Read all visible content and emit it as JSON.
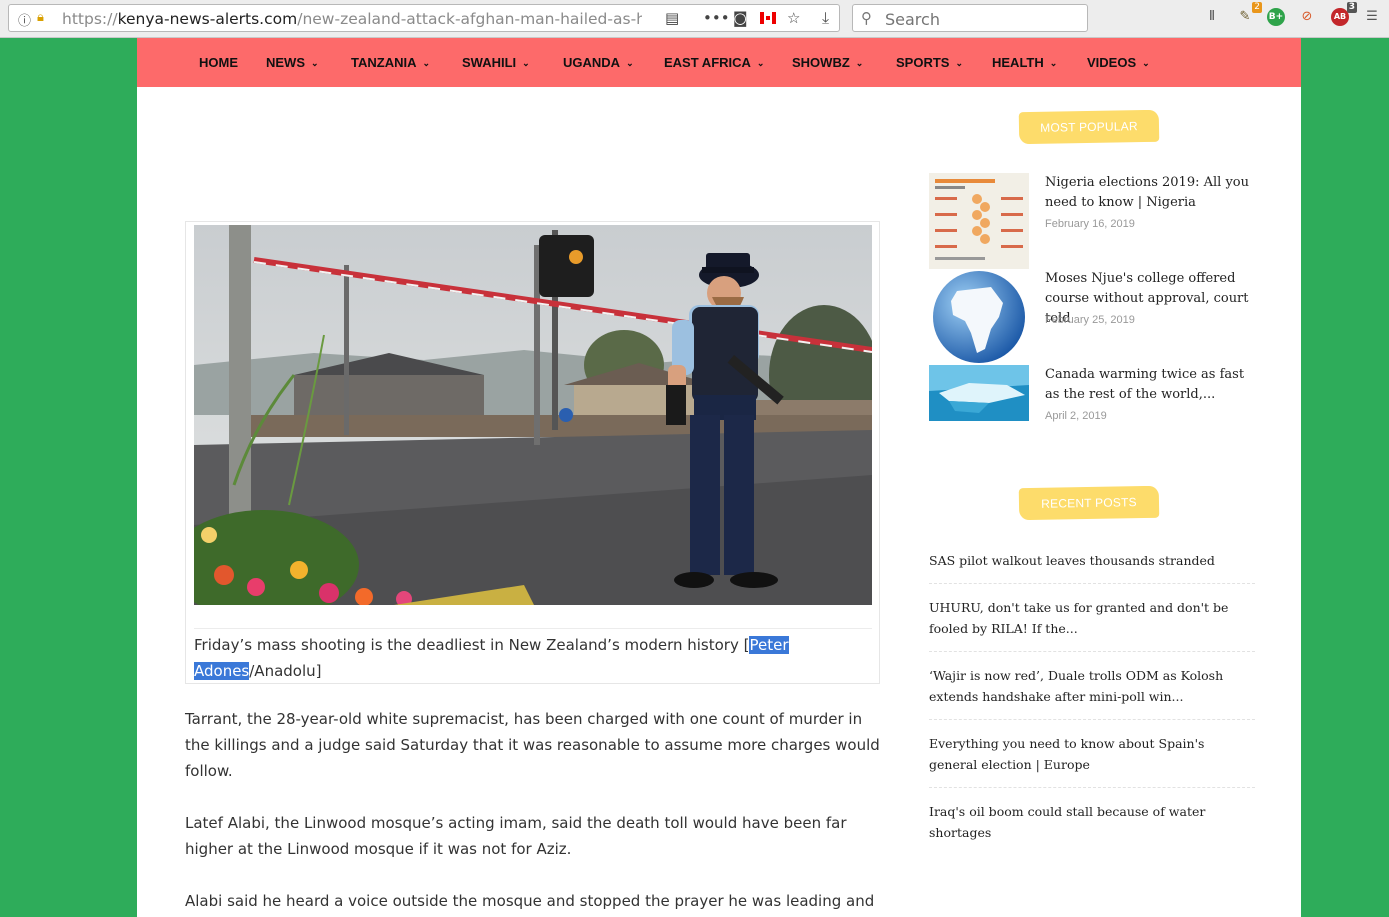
{
  "browser": {
    "url_prefix": "https://",
    "url_domain": "kenya-news-alerts.com",
    "url_path": "/new-zealand-attack-afghan-man-hailed-as-h",
    "search_placeholder": "Search",
    "ext_badge_1": "2",
    "ext_badge_2": "3"
  },
  "nav": {
    "items": [
      "HOME",
      "NEWS",
      "TANZANIA",
      "SWAHILI",
      "UGANDA",
      "EAST AFRICA",
      "SHOWBZ",
      "SPORTS",
      "HEALTH",
      "VIDEOS"
    ]
  },
  "article": {
    "caption_pre": "Friday’s mass shooting is the deadliest in New Zealand’s modern history [",
    "caption_highlight": "Peter Adones",
    "caption_post": "/Anadolu]",
    "paragraphs": [
      "Tarrant, the 28-year-old white supremacist, has been charged with one count of murder in the killings and a judge said Saturday that it was reasonable to assume more charges would follow.",
      "Latef Alabi, the Linwood mosque’s acting imam, said the death toll would have been far higher at the Linwood mosque if it was not for Aziz.",
      "Alabi said he heard a voice outside the mosque and stopped the prayer he was leading and"
    ]
  },
  "sidebar": {
    "popular_title": "MOST POPULAR",
    "popular": [
      {
        "title": "Nigeria elections 2019: All you need to know | Nigeria",
        "date": "February 16, 2019"
      },
      {
        "title": "Moses Njue's college offered course without approval, court told",
        "date": "February 25, 2019"
      },
      {
        "title": "Canada warming twice as fast as the rest of the world,...",
        "date": "April 2, 2019"
      }
    ],
    "recent_title": "RECENT POSTS",
    "recent": [
      "SAS pilot walkout leaves thousands stranded",
      "UHURU, don't take us for granted and don't be fooled by RILA! If the...",
      "‘Wajir is now red’, Duale trolls ODM as Kolosh extends handshake after mini-poll win...",
      "Everything you need to know about Spain's general election | Europe",
      "Iraq's oil boom could stall because of water shortages"
    ]
  }
}
